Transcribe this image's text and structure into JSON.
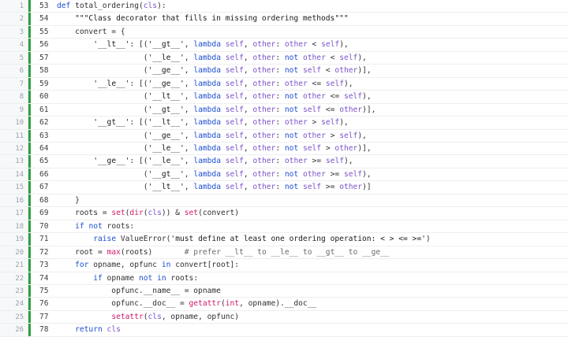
{
  "code_lines": [
    {
      "gutter_no": "1",
      "source_no": "53",
      "code": "def total_ordering(cls):"
    },
    {
      "gutter_no": "2",
      "source_no": "54",
      "code": "    \"\"\"Class decorator that fills in missing ordering methods\"\"\""
    },
    {
      "gutter_no": "3",
      "source_no": "55",
      "code": "    convert = {"
    },
    {
      "gutter_no": "4",
      "source_no": "56",
      "code": "        '__lt__': [('__gt__', lambda self, other: other < self),"
    },
    {
      "gutter_no": "5",
      "source_no": "57",
      "code": "                   ('__le__', lambda self, other: not other < self),"
    },
    {
      "gutter_no": "6",
      "source_no": "58",
      "code": "                   ('__ge__', lambda self, other: not self < other)],"
    },
    {
      "gutter_no": "7",
      "source_no": "59",
      "code": "        '__le__': [('__ge__', lambda self, other: other <= self),"
    },
    {
      "gutter_no": "8",
      "source_no": "60",
      "code": "                   ('__lt__', lambda self, other: not other <= self),"
    },
    {
      "gutter_no": "9",
      "source_no": "61",
      "code": "                   ('__gt__', lambda self, other: not self <= other)],"
    },
    {
      "gutter_no": "10",
      "source_no": "62",
      "code": "        '__gt__': [('__lt__', lambda self, other: other > self),"
    },
    {
      "gutter_no": "11",
      "source_no": "63",
      "code": "                   ('__ge__', lambda self, other: not other > self),"
    },
    {
      "gutter_no": "12",
      "source_no": "64",
      "code": "                   ('__le__', lambda self, other: not self > other)],"
    },
    {
      "gutter_no": "13",
      "source_no": "65",
      "code": "        '__ge__': [('__le__', lambda self, other: other >= self),"
    },
    {
      "gutter_no": "14",
      "source_no": "66",
      "code": "                   ('__gt__', lambda self, other: not other >= self),"
    },
    {
      "gutter_no": "15",
      "source_no": "67",
      "code": "                   ('__lt__', lambda self, other: not self >= other)]"
    },
    {
      "gutter_no": "16",
      "source_no": "68",
      "code": "    }"
    },
    {
      "gutter_no": "17",
      "source_no": "69",
      "code": "    roots = set(dir(cls)) & set(convert)"
    },
    {
      "gutter_no": "18",
      "source_no": "70",
      "code": "    if not roots:"
    },
    {
      "gutter_no": "19",
      "source_no": "71",
      "code": "        raise ValueError('must define at least one ordering operation: < > <= >=')"
    },
    {
      "gutter_no": "20",
      "source_no": "72",
      "code": "    root = max(roots)       # prefer __lt__ to __le__ to __gt__ to __ge__"
    },
    {
      "gutter_no": "21",
      "source_no": "73",
      "code": "    for opname, opfunc in convert[root]:"
    },
    {
      "gutter_no": "22",
      "source_no": "74",
      "code": "        if opname not in roots:"
    },
    {
      "gutter_no": "23",
      "source_no": "75",
      "code": "            opfunc.__name__ = opname"
    },
    {
      "gutter_no": "24",
      "source_no": "76",
      "code": "            opfunc.__doc__ = getattr(int, opname).__doc__"
    },
    {
      "gutter_no": "25",
      "source_no": "77",
      "code": "            setattr(cls, opname, opfunc)"
    },
    {
      "gutter_no": "26",
      "source_no": "78",
      "code": "    return cls"
    }
  ],
  "colors": {
    "accent_bar": "#2ea043",
    "keyword": "#1f4fd1",
    "builtin": "#d11a6a",
    "argument": "#7a52c9"
  }
}
